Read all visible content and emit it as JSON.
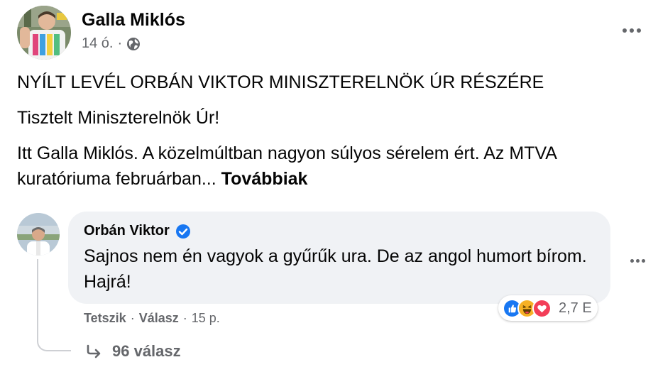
{
  "post": {
    "author": "Galla Miklós",
    "time": "14 ó.",
    "separator": "·",
    "privacy_icon": "globe-icon",
    "more_icon": "more-horizontal-icon",
    "title": "NYÍLT LEVÉL ORBÁN VIKTOR MINISZTERELNÖK ÚR RÉSZÉRE",
    "greeting": "Tisztelt Miniszterelnök Úr!",
    "excerpt": "Itt Galla Miklós. A közelmúltban nagyon súlyos sérelem ért. Az MTVA kuratóriuma februárban...",
    "see_more": "Továbbiak"
  },
  "comment": {
    "author": "Orbán Viktor",
    "verified_icon": "verified-badge-icon",
    "text": "Sajnos nem én vagyok a gyűrűk ura. De az angol humort bírom. Hajrá!",
    "like_label": "Tetszik",
    "reply_label": "Válasz",
    "time": "15 p.",
    "separator": "·",
    "reaction_icons": [
      "like-icon",
      "haha-icon",
      "love-icon"
    ],
    "reaction_count": "2,7 E",
    "replies": "96 válasz"
  },
  "colors": {
    "text": "#050505",
    "secondary": "#65676b",
    "bubble": "#f0f2f5",
    "like": "#1877f2",
    "love": "#f33e58",
    "haha": "#f7b125",
    "verified": "#1877f2"
  }
}
